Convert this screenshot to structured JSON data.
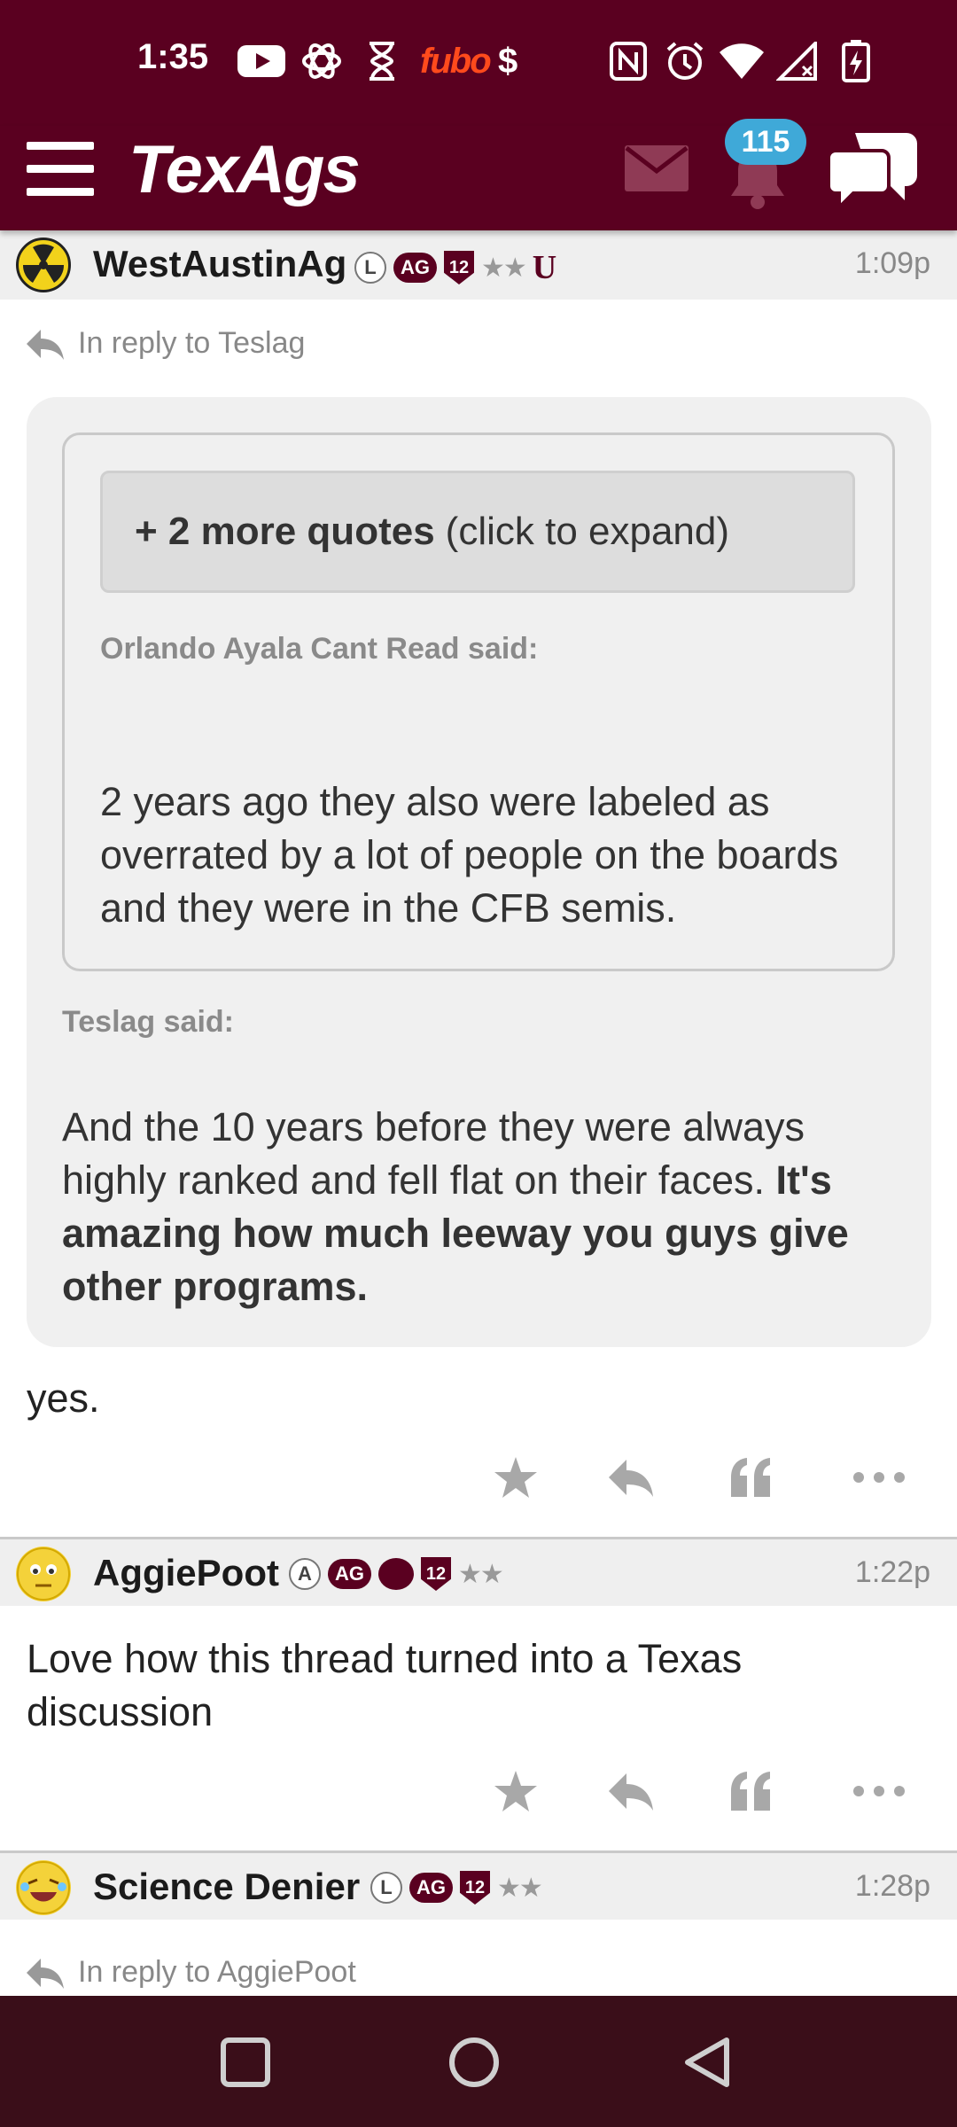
{
  "status_bar": {
    "time": "1:35",
    "left_icons": [
      "youtube-icon",
      "chatgpt-icon",
      "hourglass-icon",
      "fubo-icon",
      "dollar-icon"
    ],
    "fubo_text": "fubo",
    "dollar_text": "$",
    "right_icons": [
      "nfc-icon",
      "alarm-icon",
      "wifi-icon",
      "signal-icon",
      "battery-charging-icon"
    ]
  },
  "header": {
    "logo": "TexAgs",
    "notification_count": "115",
    "colors": {
      "maroon": "#5a0020",
      "badge_blue": "#3fa9d8"
    }
  },
  "posts": [
    {
      "username": "WestAustinAg",
      "badges": [
        "L",
        "AG",
        "12",
        "★★",
        "U"
      ],
      "time": "1:09p",
      "reply_to": "In reply to Teslag",
      "expand_strong": "+ 2 more quotes",
      "expand_rest": "(click to expand)",
      "inner_quote_author": "Orlando Ayala Cant Read said:",
      "inner_quote_text": "2 years ago they also were labeled as overrated by a lot of people on the boards and they were in the CFB semis.",
      "outer_quote_author": "Teslag said:",
      "outer_quote_text": "And the 10 years before they were always highly ranked and fell flat on their faces.",
      "outer_quote_bold": "It's amazing how much leeway you guys give other programs.",
      "body": "yes."
    },
    {
      "username": "AggiePoot",
      "badges": [
        "A",
        "AG",
        "12",
        "★★"
      ],
      "time": "1:22p",
      "body": "Love how this thread turned into a Texas discussion"
    },
    {
      "username": "Science Denier",
      "badges": [
        "L",
        "AG",
        "12",
        "★★"
      ],
      "time": "1:28p",
      "reply_to": "In reply to AggiePoot"
    }
  ],
  "actions": [
    "star-icon",
    "reply-icon",
    "quote-icon",
    "more-icon"
  ],
  "nav_bar": [
    "recents-button",
    "home-button",
    "back-button"
  ]
}
